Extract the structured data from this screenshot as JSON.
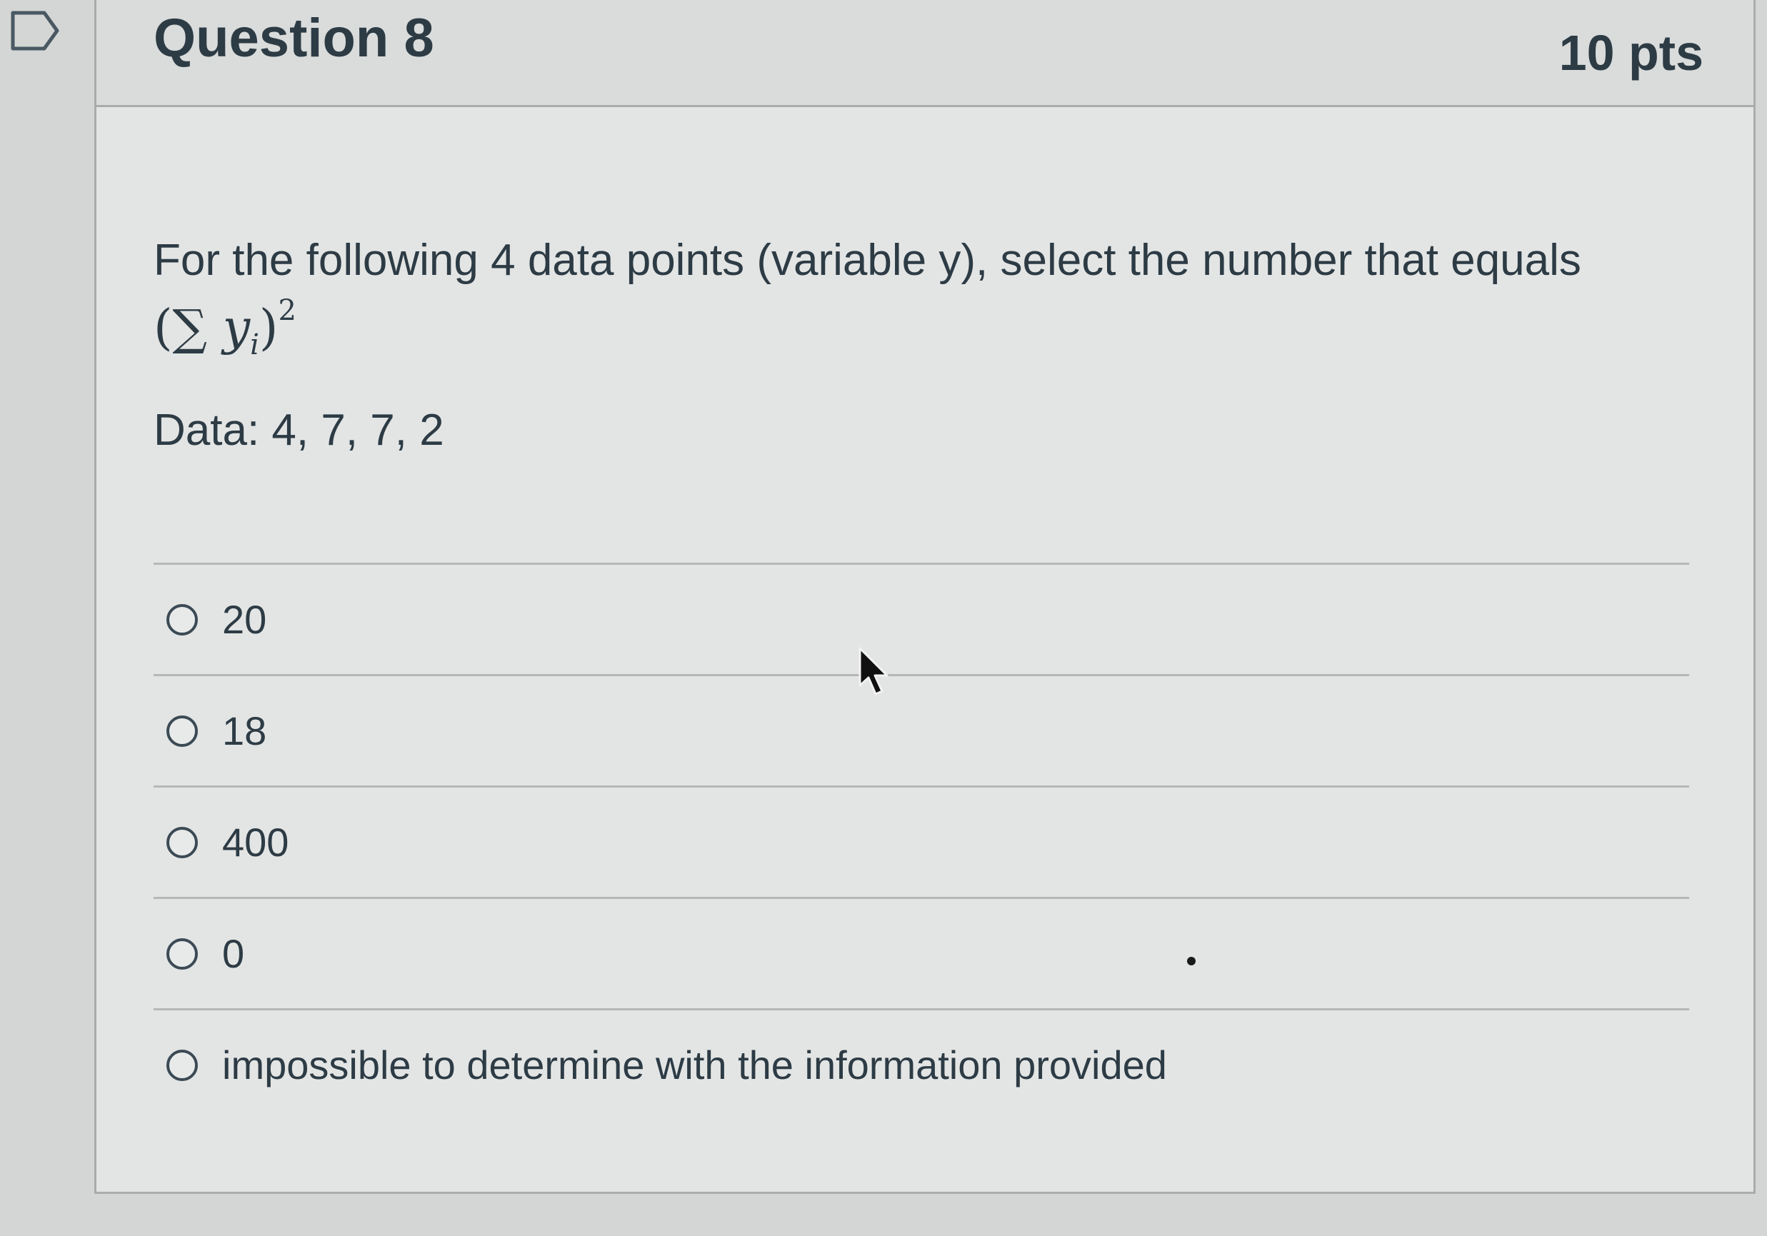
{
  "question": {
    "title": "Question 8",
    "points": "10 pts",
    "prompt": "For the following 4 data points (variable y), select the number that equals",
    "formula": {
      "open": "(∑ ",
      "var": "y",
      "subscript": "i",
      "close": ")",
      "exponent": "2"
    },
    "data_text": "Data: 4, 7, 7, 2"
  },
  "answers": [
    {
      "label": "20",
      "selected": false
    },
    {
      "label": "18",
      "selected": false
    },
    {
      "label": "400",
      "selected": false
    },
    {
      "label": "0",
      "selected": false
    },
    {
      "label": "impossible to determine with the information provided",
      "selected": false
    }
  ],
  "icons": {
    "bookmark": "bookmark-flag-icon",
    "cursor": "mouse-pointer-icon"
  },
  "colors": {
    "text": "#2d3b45",
    "header_bg": "#d9dcdb",
    "card_bg": "#e3e5e4",
    "border": "#a9acab"
  }
}
